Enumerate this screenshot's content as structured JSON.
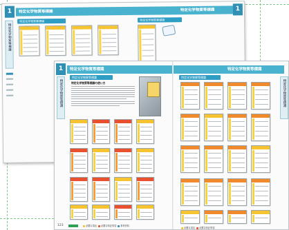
{
  "chapter_number": "1",
  "catalog_title": "特定化学物質等標識",
  "section_heading": "特定化学物質等標識",
  "spine_label": "特定化学物質等標識",
  "page_numbers": {
    "back_left": "123",
    "front_left": "123"
  },
  "front_article_heading": "特定化学物質等標識の使い方",
  "footer_legend": [
    "必要な項目",
    "必要な特記事項",
    "参考資料"
  ],
  "colors": {
    "header": "#49b3cf",
    "accent": "#2f8fb4",
    "sign_yellow": "#f5c430",
    "sign_red": "#e8502e",
    "guide_line": "#7cc98a"
  },
  "icons": [
    "sign-thumbnail-icon",
    "product-photo-icon",
    "approval-stamp-icon"
  ]
}
